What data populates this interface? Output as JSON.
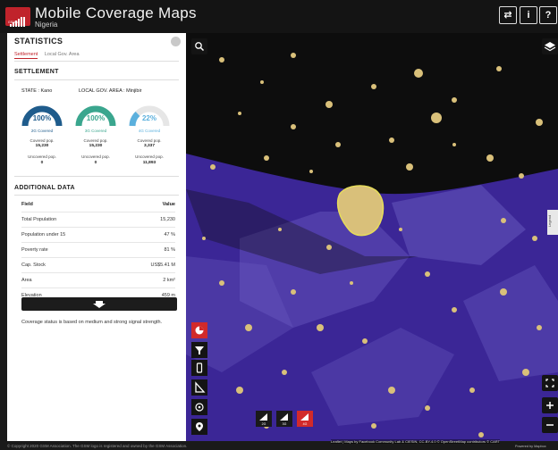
{
  "header": {
    "title": "Mobile Coverage Maps",
    "subtitle": "Nigeria",
    "logo_text": "GSMA",
    "buttons": [
      {
        "name": "share-button",
        "glyph": "⇄"
      },
      {
        "name": "info-button",
        "glyph": "i"
      },
      {
        "name": "help-button",
        "glyph": "?"
      }
    ]
  },
  "sidebar": {
    "title": "STATISTICS",
    "tabs": [
      {
        "label": "Settlement",
        "active": true
      },
      {
        "label": "Local Gov. Area",
        "active": false
      }
    ],
    "settlement_title": "SETTLEMENT",
    "state_label": "STATE : Kano",
    "lga_label": "LOCAL GOV. AREA : Minjibir",
    "gauges": [
      {
        "value": "100%",
        "label": "2G Covered",
        "fraction": 1.0,
        "color": "#1f5c8c",
        "covered_label": "Covered pop.",
        "covered_value": "15,230",
        "uncovered_label": "Uncovered pop.",
        "uncovered_value": "0"
      },
      {
        "value": "100%",
        "label": "3G Covered",
        "fraction": 1.0,
        "color": "#3aa68e",
        "covered_label": "Covered pop.",
        "covered_value": "15,230",
        "uncovered_label": "Uncovered pop.",
        "uncovered_value": "0"
      },
      {
        "value": "22%",
        "label": "4G Covered",
        "fraction": 0.22,
        "color": "#5bb0dd",
        "covered_label": "Covered pop.",
        "covered_value": "3,337",
        "uncovered_label": "Uncovered pop.",
        "uncovered_value": "11,893"
      }
    ],
    "additional_title": "ADDITIONAL DATA",
    "table": {
      "headers": [
        "Field",
        "Value"
      ],
      "rows": [
        [
          "Total Population",
          "15,230"
        ],
        [
          "Population under 15",
          "47 %"
        ],
        [
          "Poverty rate",
          "81 %"
        ],
        [
          "Cap. Stock",
          "US$5.41 M"
        ],
        [
          "Area",
          "2 km²"
        ],
        [
          "Elevation",
          "459 m"
        ]
      ]
    },
    "note": "Coverage status is based on medium and strong signal strength."
  },
  "map": {
    "network_buttons": [
      {
        "label": "2G",
        "active": false
      },
      {
        "label": "3G",
        "active": false
      },
      {
        "label": "4G",
        "active": true
      }
    ],
    "legend_label": "Legend",
    "attribution": "Leaflet | Maps by Facebook Community Lab & CIESIN, CC-BY-4.0 © OpenStreetMap contributors © CART",
    "powered_by": "Powered by Mapbox"
  },
  "footer": {
    "copyright": "© Copyright 2020 GSM Association. The GSM logo is registered and owned by the GSM Association."
  },
  "colors": {
    "accent": "#c0232b",
    "map_dark": "#0d0d0d",
    "map_purple": "#3b2696",
    "map_lightpurple": "#6a5cc0",
    "settlement": "#d9c07a"
  }
}
